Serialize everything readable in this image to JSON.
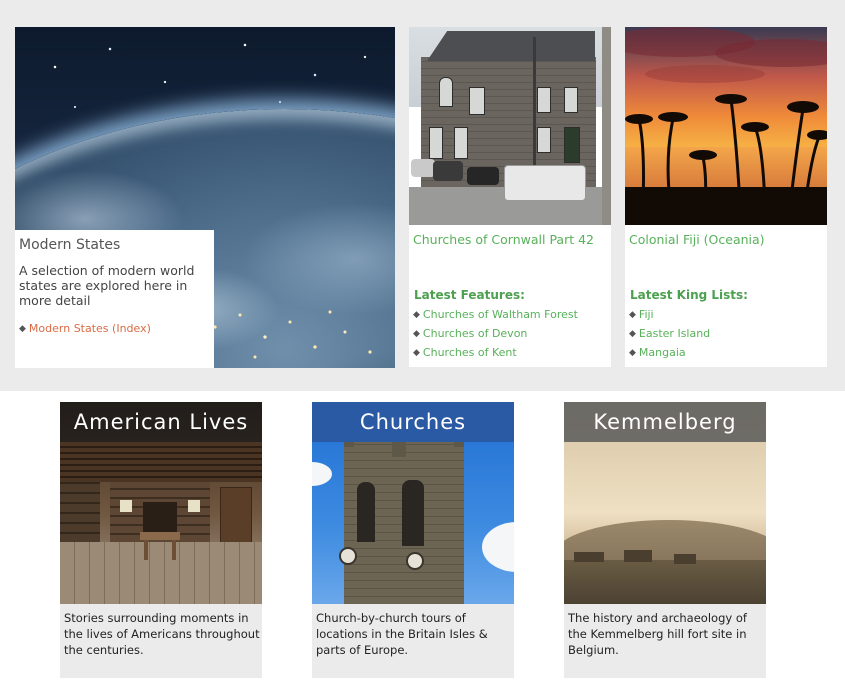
{
  "featured": {
    "title": "Modern States",
    "description": "A selection of modern world states are explored here in more detail",
    "link": "Modern States (Index)"
  },
  "cards": [
    {
      "title": "Churches of Cornwall Part 42",
      "section_heading": "Latest Features:",
      "links": [
        "Churches of Waltham Forest",
        "Churches of Devon",
        "Churches of Kent"
      ]
    },
    {
      "title": "Colonial Fiji (Oceania)",
      "section_heading": "Latest King Lists:",
      "links": [
        "Fiji",
        "Easter Island",
        "Mangaia"
      ]
    }
  ],
  "bottom_cards": [
    {
      "banner": "American Lives",
      "description": "Stories surrounding moments in the lives of Americans throughout the centuries."
    },
    {
      "banner": "Churches",
      "description": "Church-by-church tours of locations in the Britain Isles & parts of Europe."
    },
    {
      "banner": "Kemmelberg",
      "description": "The history and archaeology of the Kemmelberg hill fort site in Belgium."
    }
  ],
  "colors": {
    "link_orange": "#d96b45",
    "link_green": "#58b15a",
    "heading_green": "#4ca04f",
    "banner_blue": "#2a5aa4",
    "band_grey": "#ebebeb"
  }
}
